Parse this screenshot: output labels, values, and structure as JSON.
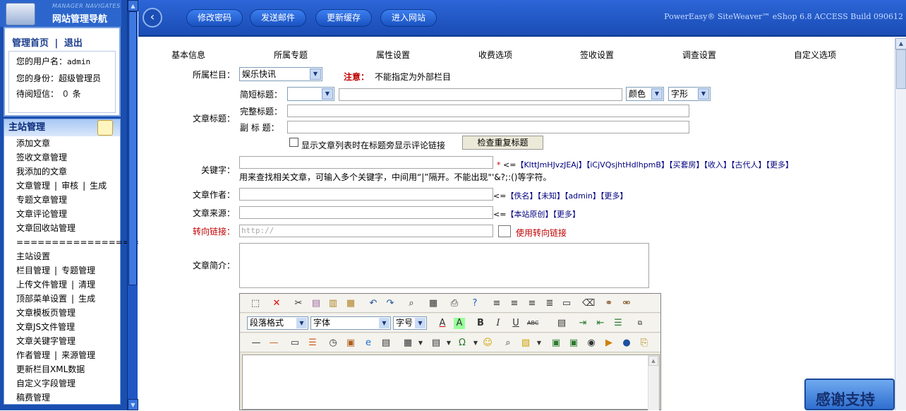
{
  "nav": {
    "logo_en": "MANAGER NAVIGATES",
    "logo_cn": "网站管理导航",
    "home_link": "管理首页",
    "link_separator": "|",
    "logout_link": "退出",
    "username_label": "您的用户名：",
    "username": "admin",
    "identity_label": "您的身份：",
    "identity": "超级管理员",
    "messages_label": "待阅短信：",
    "messages_count": "0",
    "messages_unit": "条"
  },
  "menu": {
    "title": "主站管理",
    "items": [
      {
        "parts": [
          "添加文章"
        ]
      },
      {
        "parts": [
          "签收文章管理"
        ]
      },
      {
        "parts": [
          "我添加的文章"
        ]
      },
      {
        "parts": [
          "文章管理",
          "审核",
          "生成"
        ]
      },
      {
        "parts": [
          "专题文章管理"
        ]
      },
      {
        "parts": [
          "文章评论管理"
        ]
      },
      {
        "parts": [
          "文章回收站管理"
        ]
      },
      {
        "parts": [
          "===================="
        ]
      },
      {
        "parts": [
          "主站设置"
        ]
      },
      {
        "parts": [
          "栏目管理",
          "专题管理"
        ]
      },
      {
        "parts": [
          "上传文件管理",
          "清理"
        ]
      },
      {
        "parts": [
          "顶部菜单设置",
          "生成"
        ]
      },
      {
        "parts": [
          "文章模板页管理"
        ]
      },
      {
        "parts": [
          "文章JS文件管理"
        ]
      },
      {
        "parts": [
          "文章关键字管理"
        ]
      },
      {
        "parts": [
          "作者管理",
          "来源管理"
        ]
      },
      {
        "parts": [
          "更新栏目XML数据"
        ]
      },
      {
        "parts": [
          "自定义字段管理"
        ]
      },
      {
        "parts": [
          "稿费管理"
        ]
      }
    ]
  },
  "topbar": {
    "back_icon": "chevron-left-icon",
    "buttons": [
      "修改密码",
      "发送邮件",
      "更新缓存",
      "进入网站"
    ],
    "version": "PowerEasy® SiteWeaver™ eShop 6.8 ACCESS Build 090612"
  },
  "tabs": [
    "基本信息",
    "所属专题",
    "属性设置",
    "收费选项",
    "签收设置",
    "调查设置",
    "自定义选项"
  ],
  "form": {
    "column_label": "所属栏目：",
    "column_value": "娱乐快讯",
    "column_note_label": "注意：",
    "column_note": "不能指定为外部栏目",
    "title_label": "文章标题：",
    "short_title_label": "简短标题：",
    "color_select": "颜色",
    "font_select": "字形",
    "full_title_label": "完整标题：",
    "sub_title_label": "副 标 题：",
    "show_comment_link": "显示文章列表时在标题旁显示评论链接",
    "check_duplicate_btn": "检查重复标题",
    "keyword_label": "关键字：",
    "keyword_required": "*",
    "keyword_arrow": "<=",
    "keyword_suggestions": [
      "KlttJmHJvzJEAj",
      "iCjVQsjhtHdlhpmB",
      "买套房",
      "收入",
      "古代人",
      "更多"
    ],
    "keyword_hint": "用来查找相关文章，可输入多个关键字，中间用“|”隔开。不能出现\"'&?;:()等字符。",
    "author_label": "文章作者：",
    "author_arrow": "<=",
    "author_suggestions": [
      "佚名",
      "未知",
      "admin",
      "更多"
    ],
    "source_label": "文章来源：",
    "source_arrow": "<=",
    "source_suggestions": [
      "本站原创",
      "更多"
    ],
    "redirect_label": "转向链接：",
    "redirect_placeholder": "http://",
    "use_redirect": "使用转向链接",
    "intro_label": "文章简介："
  },
  "editor": {
    "paragraph_select": "段落格式",
    "font_select": "字体",
    "size_select": "字号"
  },
  "thanks_badge": "感谢支持",
  "colors": {
    "nav_blue": "#1a4fb0",
    "topbar_blue": "#2c66d8",
    "warning_red": "#c00000",
    "link_navy": "#000080"
  }
}
